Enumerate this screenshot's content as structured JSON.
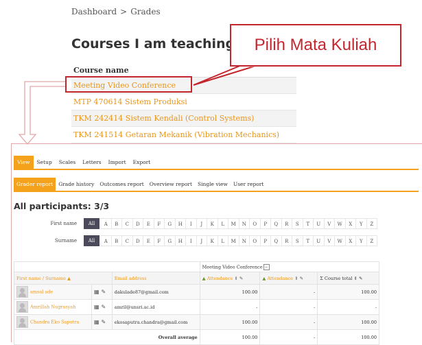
{
  "breadcrumb": {
    "items": [
      "Dashboard",
      "Grades"
    ],
    "separator": ">"
  },
  "page_title": "Courses I am teaching",
  "courses": {
    "header": "Course name",
    "rows": [
      "Meeting Video Conference",
      "MTP 470614 Sistem Produksi",
      "TKM 242414 Sistem Kendali (Control Systems)",
      "TKM 241514 Getaran Mekanik (Vibration Mechanics)"
    ]
  },
  "callout": {
    "text": "Pilih Mata Kuliah"
  },
  "colors": {
    "accent": "#f4a21b",
    "link": "#e8961a",
    "annotation": "#c4262e",
    "filter_active": "#4a4a5a"
  },
  "tabs_primary": [
    "View",
    "Setup",
    "Scales",
    "Letters",
    "Import",
    "Export"
  ],
  "tabs_secondary": [
    "Grader report",
    "Grade history",
    "Outcomes report",
    "Overview report",
    "Single view",
    "User report"
  ],
  "participants_title": "All participants: 3/3",
  "filters": {
    "first_name_label": "First name",
    "surname_label": "Surname",
    "all_label": "All",
    "letters": [
      "A",
      "B",
      "C",
      "D",
      "E",
      "F",
      "G",
      "H",
      "I",
      "J",
      "K",
      "L",
      "M",
      "N",
      "O",
      "P",
      "Q",
      "R",
      "S",
      "T",
      "U",
      "V",
      "W",
      "X",
      "Y",
      "Z"
    ]
  },
  "grader": {
    "course_header": "Meeting Video Conference",
    "col_name": "First name / Surname",
    "col_email": "Email address",
    "col_att1": "Attendance",
    "col_att2": "Attendance",
    "col_total": "Course total",
    "rows": [
      {
        "name": "amsal ade",
        "email": "dakulade87@gmail.com",
        "att1": "100.00",
        "att2": "-",
        "total": "100.00"
      },
      {
        "name": "Amrillah Nugrasyah",
        "email": "amril@unsri.ac.id",
        "att1": "-",
        "att2": "-",
        "total": "-"
      },
      {
        "name": "Chandra Eko Saputra",
        "email": "ekosaputra.chandra@gmail.com",
        "att1": "100.00",
        "att2": "-",
        "total": "100.00"
      }
    ],
    "avg_label": "Overall average",
    "avg": {
      "att1": "100.00",
      "att2": "-",
      "total": "100.00"
    }
  }
}
